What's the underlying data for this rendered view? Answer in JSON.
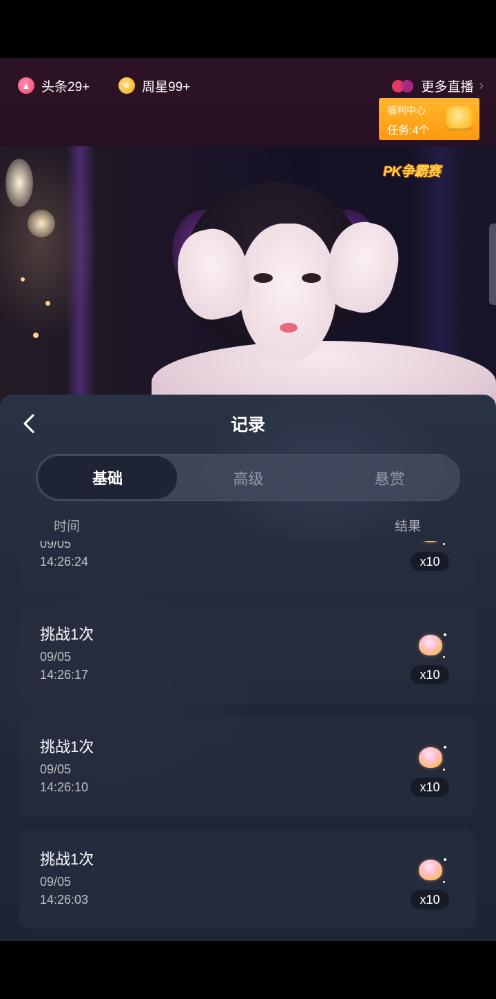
{
  "header": {
    "headline_label": "头条29+",
    "headline_icon": "flame-icon",
    "weekstar_label": "周星99+",
    "weekstar_icon": "star-icon",
    "more_live_label": "更多直播",
    "welfare": {
      "title": "福利中心",
      "tasks": "任务:4个"
    }
  },
  "video": {
    "pk_badge": "PK争霸赛"
  },
  "panel": {
    "title": "记录",
    "tabs": [
      {
        "label": "基础",
        "active": true
      },
      {
        "label": "高级",
        "active": false
      },
      {
        "label": "悬赏",
        "active": false
      }
    ],
    "columns": {
      "time": "时间",
      "result": "结果"
    },
    "records": [
      {
        "title": "",
        "date": "09/05",
        "time": "14:26:24",
        "count": "x10"
      },
      {
        "title": "挑战1次",
        "date": "09/05",
        "time": "14:26:17",
        "count": "x10"
      },
      {
        "title": "挑战1次",
        "date": "09/05",
        "time": "14:26:10",
        "count": "x10"
      },
      {
        "title": "挑战1次",
        "date": "09/05",
        "time": "14:26:03",
        "count": "x10"
      }
    ]
  },
  "colors": {
    "accent_orange": "#ff9a0f",
    "header_bg": "#2e1326",
    "panel_bg": "#222a3b"
  }
}
